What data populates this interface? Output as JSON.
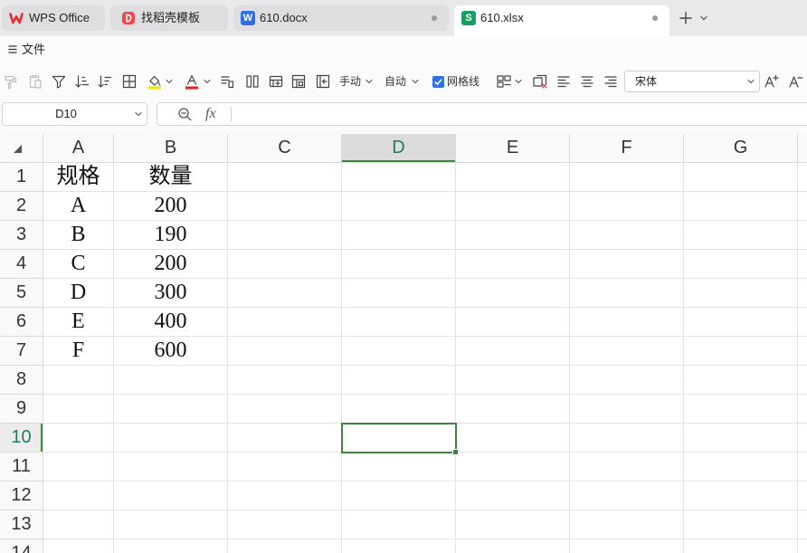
{
  "tabs": [
    {
      "label": "WPS Office",
      "icon": "wps-logo-icon"
    },
    {
      "label": "找稻壳模板",
      "icon": "docer-icon"
    },
    {
      "label": "610.docx",
      "icon": "word-document-icon",
      "icon_letter": "W"
    },
    {
      "label": "610.xlsx",
      "icon": "spreadsheet-icon",
      "icon_letter": "S",
      "active": true
    }
  ],
  "menu": {
    "file_label": "文件"
  },
  "toolbar": {
    "manual_label": "手动",
    "auto_label": "自动",
    "gridlines_label": "网格线",
    "gridlines_checked": true,
    "font_name": "宋体"
  },
  "formula_bar": {
    "name_box": "D10",
    "fx_label": "fx",
    "content": ""
  },
  "sheet": {
    "columns": [
      "A",
      "B",
      "C",
      "D",
      "E",
      "F",
      "G"
    ],
    "rows": [
      "1",
      "2",
      "3",
      "4",
      "5",
      "6",
      "7",
      "8",
      "9",
      "10",
      "11",
      "12",
      "13",
      "14"
    ],
    "selected_cell": "D10",
    "data": [
      [
        "规格",
        "数量"
      ],
      [
        "A",
        "200"
      ],
      [
        "B",
        "190"
      ],
      [
        "C",
        "200"
      ],
      [
        "D",
        "300"
      ],
      [
        "E",
        "400"
      ],
      [
        "F",
        "600"
      ]
    ]
  },
  "colors": {
    "selection": "#3a8a3e",
    "header_selected_text": "#1e7a62",
    "checkbox": "#2f72e0",
    "fill_color": "#f2e600",
    "font_color": "#e02020",
    "clear_red": "#e03030",
    "wps_red": "#ea2e2e",
    "docer_red": "#f0464e",
    "word_blue": "#2e6ee6",
    "sheet_green": "#17a05d"
  }
}
